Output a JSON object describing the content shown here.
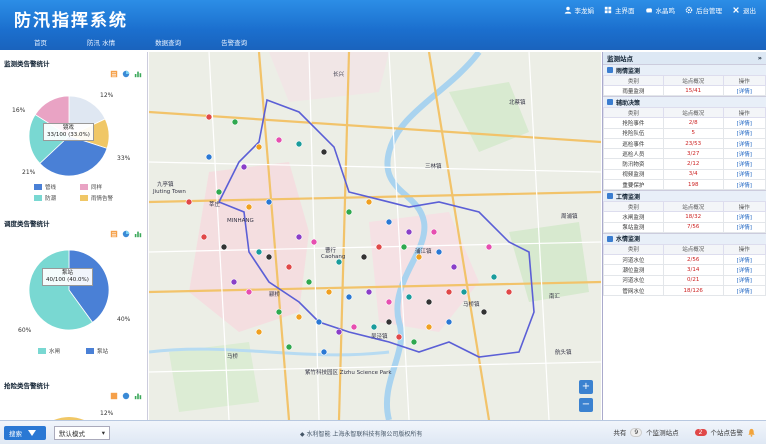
{
  "header": {
    "title": "防汛指挥系统",
    "actions": [
      {
        "icon": "user-icon",
        "label": "李龙娟"
      },
      {
        "icon": "grid-icon",
        "label": "主界面"
      },
      {
        "icon": "cloud-icon",
        "label": "水晶鸣"
      },
      {
        "icon": "gear-icon",
        "label": "后台管理"
      },
      {
        "icon": "close-icon",
        "label": "退出"
      }
    ]
  },
  "nav": [
    "首页",
    "防汛 水情",
    "数据查询",
    "告警查询"
  ],
  "left": {
    "panel1": {
      "title": "监测类告警统计",
      "tooltip_line1": "镜戏",
      "tooltip_line2": "33/100 (33.0%)",
      "labels": [
        "12%",
        "16%",
        "33%",
        "21%"
      ],
      "slices": [
        {
          "name": "管线",
          "value": 33,
          "color": "#4a80d6"
        },
        {
          "name": "防潮",
          "value": 21,
          "color": "#79d8d2"
        },
        {
          "name": "同样",
          "value": 16,
          "color": "#e9a3c4"
        },
        {
          "name": "雨情告警",
          "value": 12,
          "color": "#f0c766"
        },
        {
          "name": "",
          "value": 18,
          "color": "#dfe7f2"
        }
      ],
      "legend": [
        "管线",
        "同样",
        "防潮",
        "雨情告警"
      ]
    },
    "panel2": {
      "title": "调度类告警统计",
      "tooltip_line1": "泵站",
      "tooltip_line2": "40/100 (40.0%)",
      "labels": [
        "60%",
        "40%"
      ],
      "slices": [
        {
          "name": "水闸",
          "value": 60,
          "color": "#79d8d2"
        },
        {
          "name": "泵站",
          "value": 40,
          "color": "#4a80d6"
        }
      ],
      "legend": [
        "水闸",
        "泵站"
      ]
    },
    "panel3": {
      "title": "抢险类告警统计",
      "labels": [
        "12%"
      ]
    }
  },
  "map": {
    "labels": [
      "长兴",
      "北蔡镇",
      "三林镇",
      "九亭镇",
      "Jiuting Town",
      "MINHANG",
      "莘庄",
      "曹行",
      "Caohang",
      "浦江镇",
      "周浦镇",
      "颛桥",
      "吴泾镇",
      "马桥",
      "紫竹科技园区 Zizhu Science Park",
      "马桥镇",
      "航头镇",
      "南汇"
    ]
  },
  "right": {
    "title": "监测站点",
    "sections": [
      {
        "name": "雨情监测",
        "headers": [
          "类别",
          "站点概况",
          "操作"
        ],
        "rows": [
          [
            "雨量监测",
            "15/41",
            "[详情]"
          ]
        ]
      },
      {
        "name": "辅助决策",
        "headers": [
          "类别",
          "站点概况",
          "操作"
        ],
        "rows": [
          [
            "抢险事件",
            "2/8",
            "[详情]"
          ],
          [
            "抢险队伍",
            "5",
            "[详情]"
          ],
          [
            "巡检事件",
            "23/53",
            "[详情]"
          ],
          [
            "巡检人员",
            "3/27",
            "[详情]"
          ],
          [
            "防汛物资",
            "2/12",
            "[详情]"
          ],
          [
            "视频监测",
            "3/4",
            "[详情]"
          ],
          [
            "重要保护",
            "198",
            "[详情]"
          ]
        ]
      },
      {
        "name": "工情监测",
        "headers": [
          "类别",
          "站点概况",
          "操作"
        ],
        "rows": [
          [
            "水闸监测",
            "18/32",
            "[详情]"
          ],
          [
            "泵站监测",
            "7/56",
            "[详情]"
          ]
        ]
      },
      {
        "name": "水情监测",
        "headers": [
          "类别",
          "站点概况",
          "操作"
        ],
        "rows": [
          [
            "河道水位",
            "2/56",
            "[详情]"
          ],
          [
            "潮位监测",
            "3/14",
            "[详情]"
          ],
          [
            "河道水位",
            "0/21",
            "[详情]"
          ],
          [
            "管网水位",
            "18/126",
            "[详情]"
          ]
        ]
      }
    ]
  },
  "footer": {
    "search_label": "搜索",
    "mode_label": "默认模式",
    "copyright": "◆ 水利智能 上海永智联科技有限公司版权所有",
    "total_prefix": "共有",
    "total_count": "9",
    "total_suffix": "个监测站点",
    "alarm_count": "2",
    "alarm_suffix": "个站点告警"
  }
}
